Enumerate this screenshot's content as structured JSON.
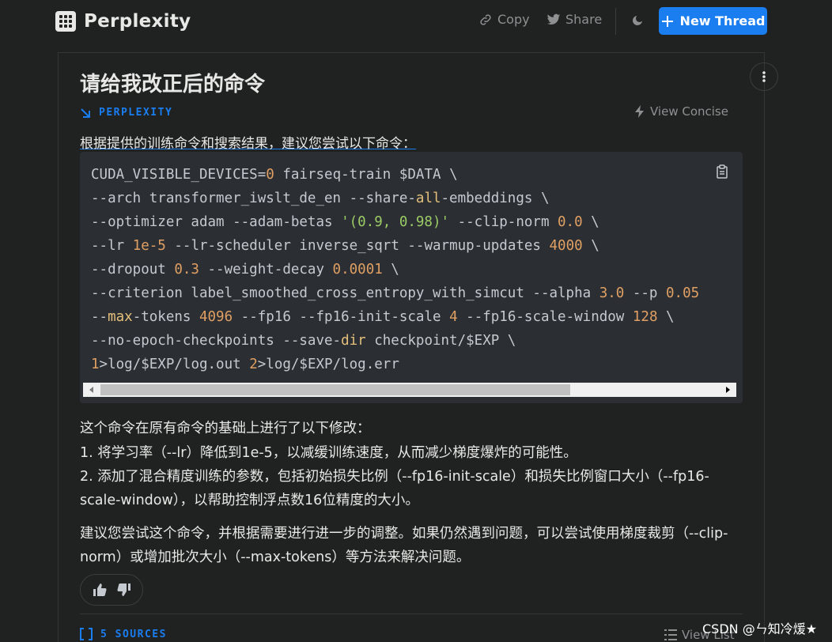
{
  "header": {
    "brand": "Perplexity",
    "copy_label": "Copy",
    "share_label": "Share",
    "new_thread_label": "New Thread"
  },
  "colors": {
    "background": "#202222",
    "accent": "#1a7df0",
    "code_background": "#2b2e33",
    "muted": "#8d9191"
  },
  "thread": {
    "title": "请给我改正后的命令",
    "source_label": "PERPLEXITY",
    "view_concise_label": "View Concise",
    "intro": "根据提供的训练命令和搜索结果，建议您尝试以下命令：",
    "code_lines": [
      [
        [
          "t",
          "CUDA_VISIBLE_DEVICES="
        ],
        [
          "n",
          "0"
        ],
        [
          "t",
          " fairseq-train $DATA \\"
        ]
      ],
      [
        [
          "t",
          "--arch transformer_iwslt_de_en --share-"
        ],
        [
          "k",
          "all"
        ],
        [
          "t",
          "-embeddings \\"
        ]
      ],
      [
        [
          "t",
          "--optimizer adam --adam-betas "
        ],
        [
          "s",
          "'(0.9, 0.98)'"
        ],
        [
          "t",
          " --clip-norm "
        ],
        [
          "n",
          "0.0"
        ],
        [
          "t",
          " \\"
        ]
      ],
      [
        [
          "t",
          "--lr "
        ],
        [
          "n",
          "1e-5"
        ],
        [
          "t",
          " --lr-scheduler inverse_sqrt --warmup-updates "
        ],
        [
          "n",
          "4000"
        ],
        [
          "t",
          " \\"
        ]
      ],
      [
        [
          "t",
          "--dropout "
        ],
        [
          "n",
          "0.3"
        ],
        [
          "t",
          " --weight-decay "
        ],
        [
          "n",
          "0.0001"
        ],
        [
          "t",
          " \\"
        ]
      ],
      [
        [
          "t",
          "--criterion label_smoothed_cross_entropy_with_simcut --alpha "
        ],
        [
          "n",
          "3.0"
        ],
        [
          "t",
          " --p "
        ],
        [
          "n",
          "0.05"
        ]
      ],
      [
        [
          "t",
          "--"
        ],
        [
          "k",
          "max"
        ],
        [
          "t",
          "-tokens "
        ],
        [
          "n",
          "4096"
        ],
        [
          "t",
          " --fp16 --fp16-init-scale "
        ],
        [
          "n",
          "4"
        ],
        [
          "t",
          " --fp16-scale-window "
        ],
        [
          "n",
          "128"
        ],
        [
          "t",
          " \\"
        ]
      ],
      [
        [
          "t",
          "--no-epoch-checkpoints --save-"
        ],
        [
          "k",
          "dir"
        ],
        [
          "t",
          " checkpoint/$EXP \\"
        ]
      ],
      [
        [
          "n",
          "1"
        ],
        [
          "t",
          ">log/$EXP/log.out "
        ],
        [
          "n",
          "2"
        ],
        [
          "t",
          ">log/$EXP/log.err"
        ]
      ]
    ],
    "answer_heading": "这个命令在原有命令的基础上进行了以下修改：",
    "changes": [
      "1. 将学习率（--lr）降低到1e-5，以减缓训练速度，从而减少梯度爆炸的可能性。",
      "2. 添加了混合精度训练的参数，包括初始损失比例（--fp16-init-scale）和损失比例窗口大小（--fp16-scale-window），以帮助控制浮点数16位精度的大小。"
    ],
    "advice": "建议您尝试这个命令，并根据需要进行进一步的调整。如果仍然遇到问题，可以尝试使用梯度裁剪（--clip-norm）或增加批次大小（--max-tokens）等方法来解决问题。",
    "sources_label": "5 SOURCES",
    "view_list_label": "View List"
  },
  "watermark": "CSDN @ㄣ知冷煖★"
}
